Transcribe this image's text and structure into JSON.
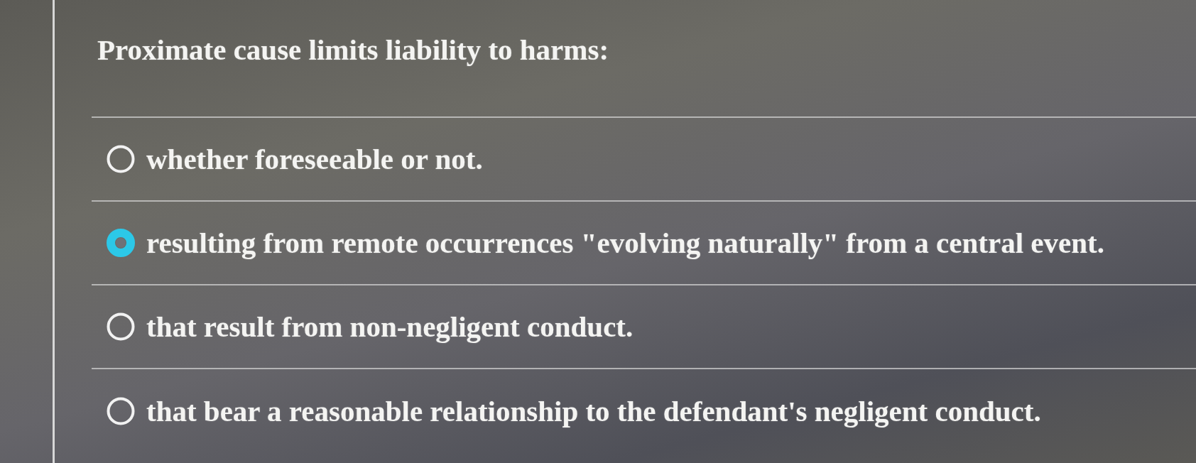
{
  "question": {
    "text": "Proximate cause limits liability to harms:"
  },
  "options": [
    {
      "label": "whether foreseeable or not.",
      "selected": false
    },
    {
      "label": "resulting from remote occurrences \"evolving naturally\" from a central event.",
      "selected": true
    },
    {
      "label": "that result from non-negligent conduct.",
      "selected": false
    },
    {
      "label": "that bear a reasonable relationship to the defendant's negligent conduct.",
      "selected": false
    }
  ]
}
